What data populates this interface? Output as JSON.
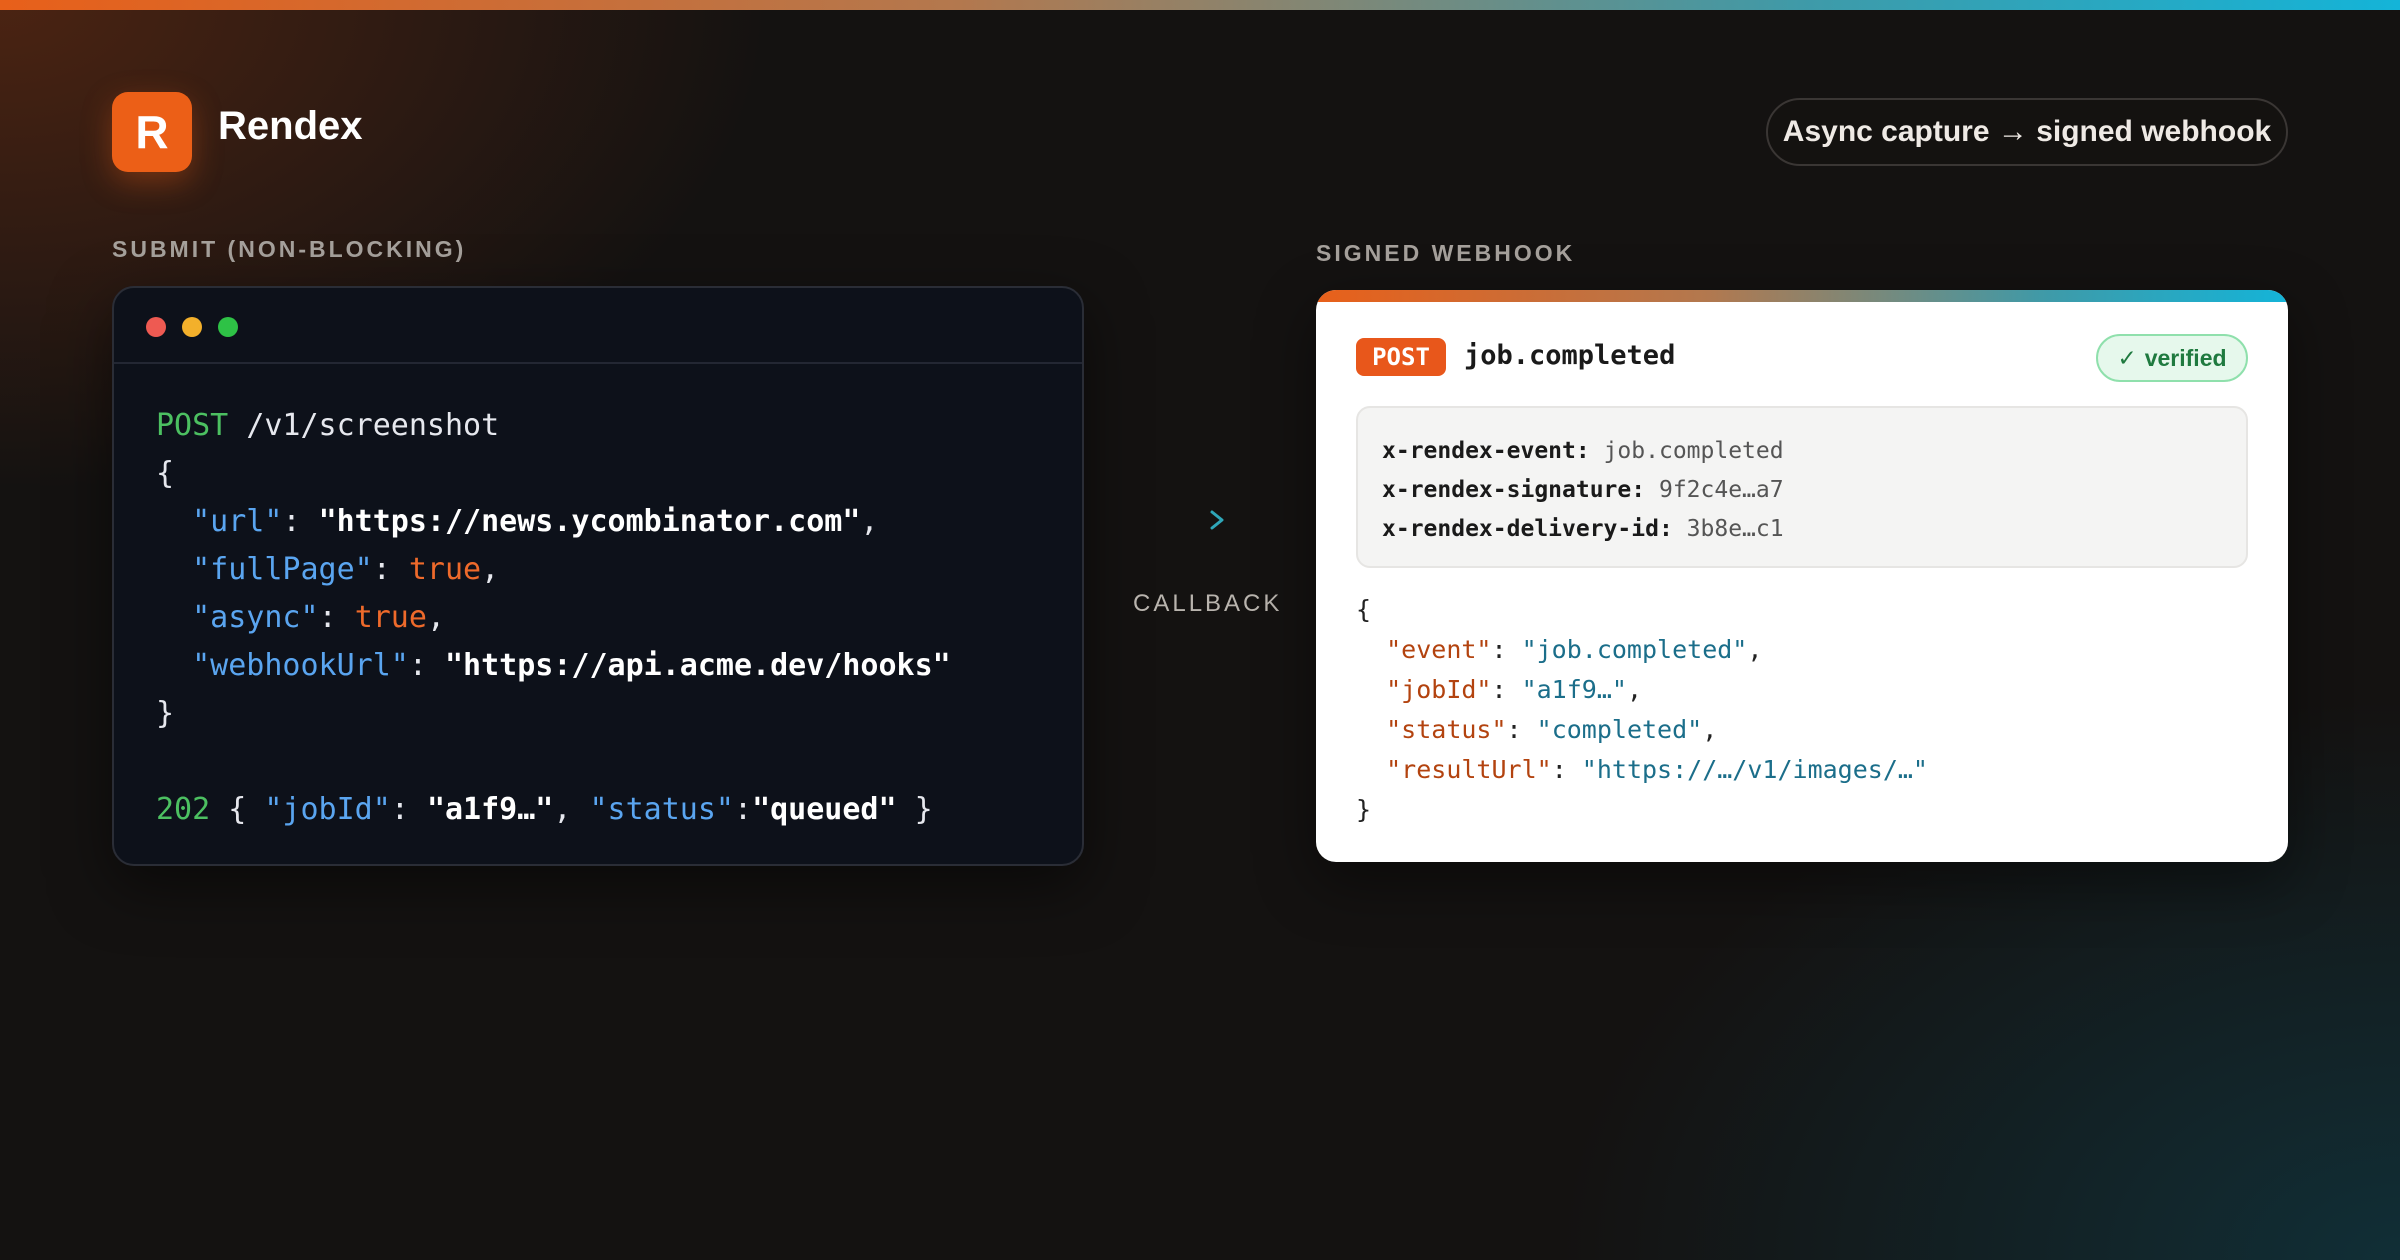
{
  "header": {
    "logo_letter": "R",
    "brand": "Rendex",
    "pill": "Async capture → signed webhook"
  },
  "submit": {
    "label": "SUBMIT (NON-BLOCKING)",
    "method": "POST",
    "path": "/v1/screenshot",
    "body": [
      {
        "key": "\"url\"",
        "value": "\"https://news.ycombinator.com\"",
        "kind": "string",
        "comma": ","
      },
      {
        "key": "\"fullPage\"",
        "value": "true",
        "kind": "bool",
        "comma": ","
      },
      {
        "key": "\"async\"",
        "value": "true",
        "kind": "bool",
        "comma": ","
      },
      {
        "key": "\"webhookUrl\"",
        "value": "\"https://api.acme.dev/hooks\"",
        "kind": "string",
        "comma": ""
      }
    ],
    "response": {
      "status": "202",
      "jobId_key": "\"jobId\"",
      "jobId_value": "\"a1f9…\"",
      "status_key": "\"status\"",
      "status_value": "\"queued\""
    }
  },
  "middle": {
    "callback": "CALLBACK"
  },
  "webhook": {
    "label": "SIGNED WEBHOOK",
    "method": "POST",
    "event": "job.completed",
    "verified": "verified",
    "verified_icon": "check-icon",
    "headers": [
      {
        "name": "x-rendex-event:",
        "value": "job.completed"
      },
      {
        "name": "x-rendex-signature:",
        "value": "9f2c4e…a7"
      },
      {
        "name": "x-rendex-delivery-id:",
        "value": "3b8e…c1"
      }
    ],
    "payload": [
      {
        "key": "\"event\"",
        "value": "\"job.completed\"",
        "comma": ","
      },
      {
        "key": "\"jobId\"",
        "value": "\"a1f9…\"",
        "comma": ","
      },
      {
        "key": "\"status\"",
        "value": "\"completed\"",
        "comma": ","
      },
      {
        "key": "\"resultUrl\"",
        "value": "\"https://…/v1/images/…\"",
        "comma": ""
      }
    ]
  },
  "colors": {
    "brand": "#ec5f17",
    "accent_teal": "#14b4d8",
    "code_bg": "#0d111a"
  }
}
